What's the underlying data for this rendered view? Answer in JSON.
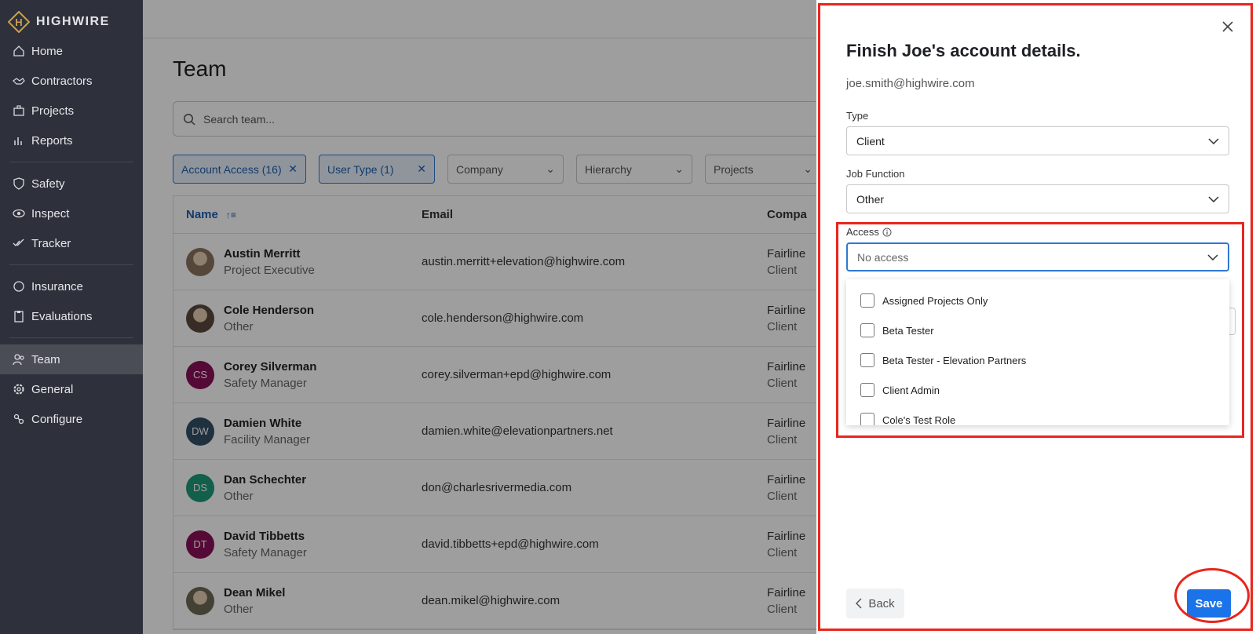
{
  "brand": {
    "name": "HIGHWIRE",
    "logo_letter": "H"
  },
  "sidebar": {
    "groups": [
      [
        {
          "label": "Home",
          "icon": "home-icon"
        },
        {
          "label": "Contractors",
          "icon": "handshake-icon"
        },
        {
          "label": "Projects",
          "icon": "briefcase-icon"
        },
        {
          "label": "Reports",
          "icon": "bar-chart-icon"
        }
      ],
      [
        {
          "label": "Safety",
          "icon": "shield-icon"
        },
        {
          "label": "Inspect",
          "icon": "eye-icon"
        },
        {
          "label": "Tracker",
          "icon": "checks-icon"
        }
      ],
      [
        {
          "label": "Insurance",
          "icon": "umbrella-icon"
        },
        {
          "label": "Evaluations",
          "icon": "clipboard-icon"
        }
      ],
      [
        {
          "label": "Team",
          "icon": "users-icon",
          "active": true
        },
        {
          "label": "General",
          "icon": "gear-icon"
        },
        {
          "label": "Configure",
          "icon": "sliders-icon"
        }
      ]
    ]
  },
  "main": {
    "title": "Team",
    "search": {
      "placeholder": "Search team..."
    },
    "filters": {
      "chips": [
        {
          "label": "Account Access (16)"
        },
        {
          "label": "User Type (1)"
        }
      ],
      "dropdowns": [
        {
          "label": "Company"
        },
        {
          "label": "Hierarchy"
        },
        {
          "label": "Projects"
        }
      ]
    },
    "table": {
      "columns": {
        "name": "Name",
        "email": "Email",
        "company": "Compa"
      },
      "rows": [
        {
          "name": "Austin Merritt",
          "role": "Project Executive",
          "email": "austin.merritt+elevation@highwire.com",
          "company": "Fairline",
          "company_type": "Client",
          "avatar": "photo",
          "color": "#8a7560"
        },
        {
          "name": "Cole Henderson",
          "role": "Other",
          "email": "cole.henderson@highwire.com",
          "company": "Fairline",
          "company_type": "Client",
          "avatar": "photo",
          "color": "#5b4a3e"
        },
        {
          "name": "Corey Silverman",
          "role": "Safety Manager",
          "email": "corey.silverman+epd@highwire.com",
          "company": "Fairline",
          "company_type": "Client",
          "initials": "CS",
          "color": "#8a1057"
        },
        {
          "name": "Damien White",
          "role": "Facility Manager",
          "email": "damien.white@elevationpartners.net",
          "company": "Fairline",
          "company_type": "Client",
          "initials": "DW",
          "color": "#334e66"
        },
        {
          "name": "Dan Schechter",
          "role": "Other",
          "email": "don@charlesrivermedia.com",
          "company": "Fairline",
          "company_type": "Client",
          "initials": "DS",
          "color": "#1d9a79"
        },
        {
          "name": "David Tibbetts",
          "role": "Safety Manager",
          "email": "david.tibbetts+epd@highwire.com",
          "company": "Fairline",
          "company_type": "Client",
          "initials": "DT",
          "color": "#8a1057"
        },
        {
          "name": "Dean Mikel",
          "role": "Other",
          "email": "dean.mikel@highwire.com",
          "company": "Fairline",
          "company_type": "Client",
          "avatar": "photo",
          "color": "#6c6a55"
        }
      ]
    }
  },
  "modal": {
    "title": "Finish Joe's account details.",
    "email": "joe.smith@highwire.com",
    "type": {
      "label": "Type",
      "value": "Client"
    },
    "job_function": {
      "label": "Job Function",
      "value": "Other"
    },
    "access": {
      "label": "Access",
      "placeholder": "No access",
      "options": [
        "Assigned Projects Only",
        "Beta Tester",
        "Beta Tester - Elevation Partners",
        "Client Admin",
        "Cole's Test Role"
      ]
    },
    "back_label": "Back",
    "save_label": "Save"
  },
  "colors": {
    "accent": "#1a73e8",
    "annotation": "#e8261d",
    "sidebar_bg": "#2e313b"
  }
}
